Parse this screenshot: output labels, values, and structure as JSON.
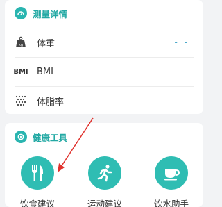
{
  "measurement": {
    "title": "测量详情",
    "rows": [
      {
        "label": "体重",
        "value": "- -",
        "icon": "weight-scale-icon"
      },
      {
        "label": "BMI",
        "value": "- -",
        "icon": "bmi-icon",
        "icon_text": "BMI"
      },
      {
        "label": "体脂率",
        "value": "- -",
        "icon": "body-fat-icon"
      }
    ]
  },
  "tools": {
    "title": "健康工具",
    "items": [
      {
        "label": "饮食建议",
        "icon": "fork-knife-icon"
      },
      {
        "label": "运动建议",
        "icon": "running-person-icon"
      },
      {
        "label": "饮水助手",
        "icon": "cup-icon"
      }
    ]
  },
  "colors": {
    "accent": "#2ab5b0",
    "value_blue": "#4aa8c9",
    "arrow_red": "#e0322d"
  }
}
